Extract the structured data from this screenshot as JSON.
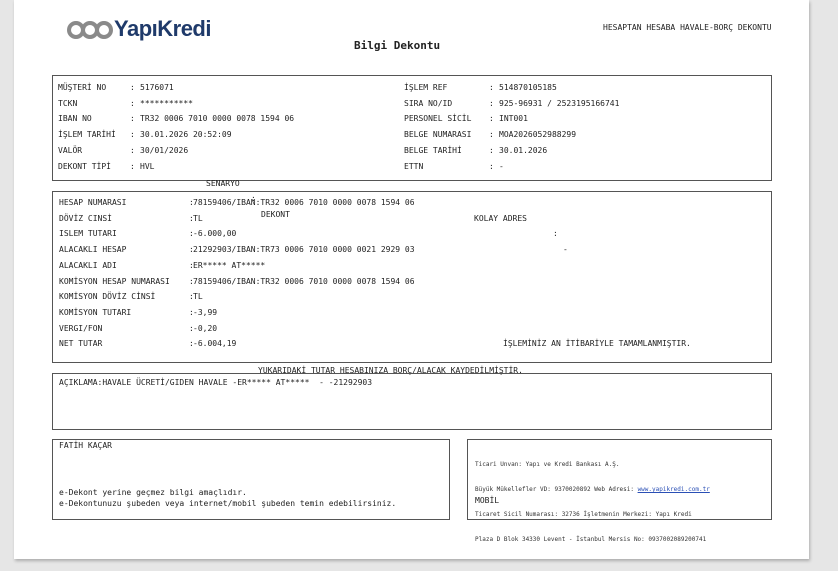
{
  "header": {
    "brand": "YapıKredi",
    "title": "Bilgi Dekontu",
    "doc_type": "HESAPTAN HESABA HAVALE-BORÇ DEKONTU"
  },
  "customer_left": [
    {
      "label": "MÜŞTERİ NO",
      "value": "5176071"
    },
    {
      "label": "TCKN",
      "value": "***********"
    },
    {
      "label": "IBAN NO",
      "value": "TR32 0006 7010 0000 0078 1594 06"
    },
    {
      "label": "İŞLEM TARİHİ",
      "value": "30.01.2026 20:52:09"
    },
    {
      "label": "VALÖR",
      "value": "30/01/2026"
    },
    {
      "label": "DEKONT TİPİ",
      "value": "HVL"
    }
  ],
  "scenario": {
    "label": "SENARYO",
    "value": "DEKONT"
  },
  "customer_right": [
    {
      "label": "İŞLEM REF",
      "value": "514870105185"
    },
    {
      "label": "SIRA NO/ID",
      "value": "925-96931 / 2523195166741"
    },
    {
      "label": "PERSONEL SİCİL",
      "value": "INT001"
    },
    {
      "label": "BELGE NUMARASI",
      "value": "MOA2026052988299"
    },
    {
      "label": "BELGE TARİHİ",
      "value": "30.01.2026"
    },
    {
      "label": "ETTN",
      "value": "-"
    }
  ],
  "transaction": [
    {
      "label": "HESAP NUMARASI",
      "value": "78159406/IBAN:TR32 0006 7010 0000 0078 1594 06"
    },
    {
      "label": "DÖVİZ CINSİ",
      "value": "TL"
    },
    {
      "label": "ISLEM TUTARI",
      "value": "-6.000,00"
    },
    {
      "label": "ALACAKLI HESAP",
      "value": "21292903/IBAN:TR73 0006 7010 0000 0021 2929 03"
    },
    {
      "label": "ALACAKLI ADI",
      "value": "ER***** AT*****"
    },
    {
      "label": "KOMİSYON HESAP NUMARASI",
      "value": "78159406/IBAN:TR32 0006 7010 0000 0078 1594 06"
    },
    {
      "label": "KOMİSYON DÖVİZ CİNSİ",
      "value": "TL"
    },
    {
      "label": "KOMİSYON TUTARI",
      "value": "-3,99"
    },
    {
      "label": "VERGI/FON",
      "value": "-0,20"
    },
    {
      "label": "NET TUTAR",
      "value": "-6.004,19"
    }
  ],
  "kolay_adres": {
    "label": "KOLAY ADRES",
    "value": "-"
  },
  "completion_note": "İŞLEMİNİZ AN İTİBARİYLE TAMAMLANMIŞTIR.",
  "debit_note": "YUKARIDAKİ TUTAR HESABINIZA BORÇ/ALACAK KAYDEDİLMİŞTİR.",
  "description": "AÇIKLAMA:HAVALE ÜCRETİ/GIDEN HAVALE -ER***** AT*****  - -21292903",
  "footer_left": {
    "name": "FATİH KAÇAR",
    "line1": "e-Dekont yerine geçmez bilgi amaçlıdır.",
    "line2": "e-Dekontunuzu şubeden veya internet/mobil şubeden temin edebilirsiniz."
  },
  "footer_right": {
    "line1": "Ticari Unvan: Yapı ve Kredi Bankası A.Ş.",
    "line2_prefix": "Büyük Mükellefler VD: 9370020892 Web Adresi: ",
    "web": "www.yapikredi.com.tr",
    "line3": "Ticaret Sicil Numarası: 32736 İşletmenin Merkezi: Yapı Kredi",
    "line4": "Plaza D Blok 34330 Levent - İstanbul Mersis No: 0937002089200741",
    "mobil": "MOBİL"
  }
}
